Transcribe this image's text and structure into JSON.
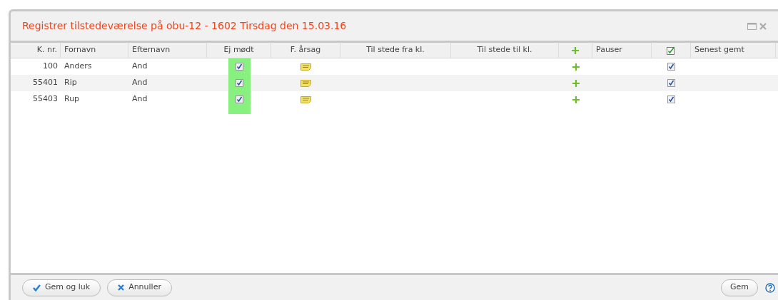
{
  "dialog": {
    "title": "Registrer tilstedeværelse på obu-12 - 1602 Tirsdag den 15.03.16"
  },
  "table": {
    "columns": [
      {
        "kind": "text",
        "label": "K. nr."
      },
      {
        "kind": "text",
        "label": "Fornavn"
      },
      {
        "kind": "text",
        "label": "Efternavn"
      },
      {
        "kind": "text",
        "label": "Ej mødt",
        "highlighted": true
      },
      {
        "kind": "text",
        "label": "F. årsag"
      },
      {
        "kind": "text",
        "label": "Til stede fra kl."
      },
      {
        "kind": "text",
        "label": "Til stede til kl."
      },
      {
        "kind": "plus"
      },
      {
        "kind": "text",
        "label": "Pauser"
      },
      {
        "kind": "check",
        "checked": true
      },
      {
        "kind": "text",
        "label": "Senest gemt"
      }
    ],
    "rows": [
      {
        "number": "100",
        "first_name": "Anders",
        "last_name": "And",
        "absent": true,
        "saved": true
      },
      {
        "number": "55401",
        "first_name": "Rip",
        "last_name": "And",
        "absent": true,
        "saved": true
      },
      {
        "number": "55403",
        "first_name": "Rup",
        "last_name": "And",
        "absent": true,
        "saved": true
      }
    ]
  },
  "footer": {
    "buttons": [
      {
        "kind": "check",
        "label": "Gem og luk"
      },
      {
        "kind": "cross",
        "label": "Annuller"
      }
    ],
    "right_button": "Gem"
  }
}
